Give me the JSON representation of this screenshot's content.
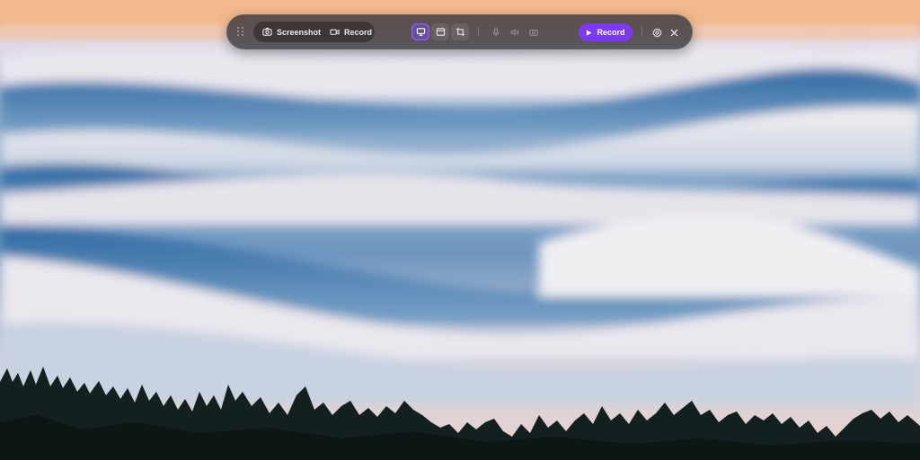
{
  "toolbar": {
    "mode_tabs": [
      {
        "label": "Screenshot",
        "icon": "camera-icon",
        "selected": true
      },
      {
        "label": "Record",
        "icon": "video-camera-icon",
        "selected": false
      }
    ],
    "capture_sources": [
      {
        "icon": "monitor-icon",
        "selected": true
      },
      {
        "icon": "window-icon",
        "selected": false
      },
      {
        "icon": "crop-icon",
        "selected": false
      }
    ],
    "media_toggles": [
      {
        "icon": "microphone-icon",
        "enabled": false
      },
      {
        "icon": "speaker-icon",
        "enabled": false
      },
      {
        "icon": "webcam-icon",
        "enabled": false
      }
    ],
    "record_button_label": "Record",
    "settings_icon": "gear-icon",
    "close_icon": "close-icon"
  },
  "colors": {
    "accent": "#7c3aed",
    "toolbar_bg": "#3a383e",
    "text": "#e9e7ee"
  },
  "wallpaper": {
    "subject": "fog-over-forest"
  }
}
